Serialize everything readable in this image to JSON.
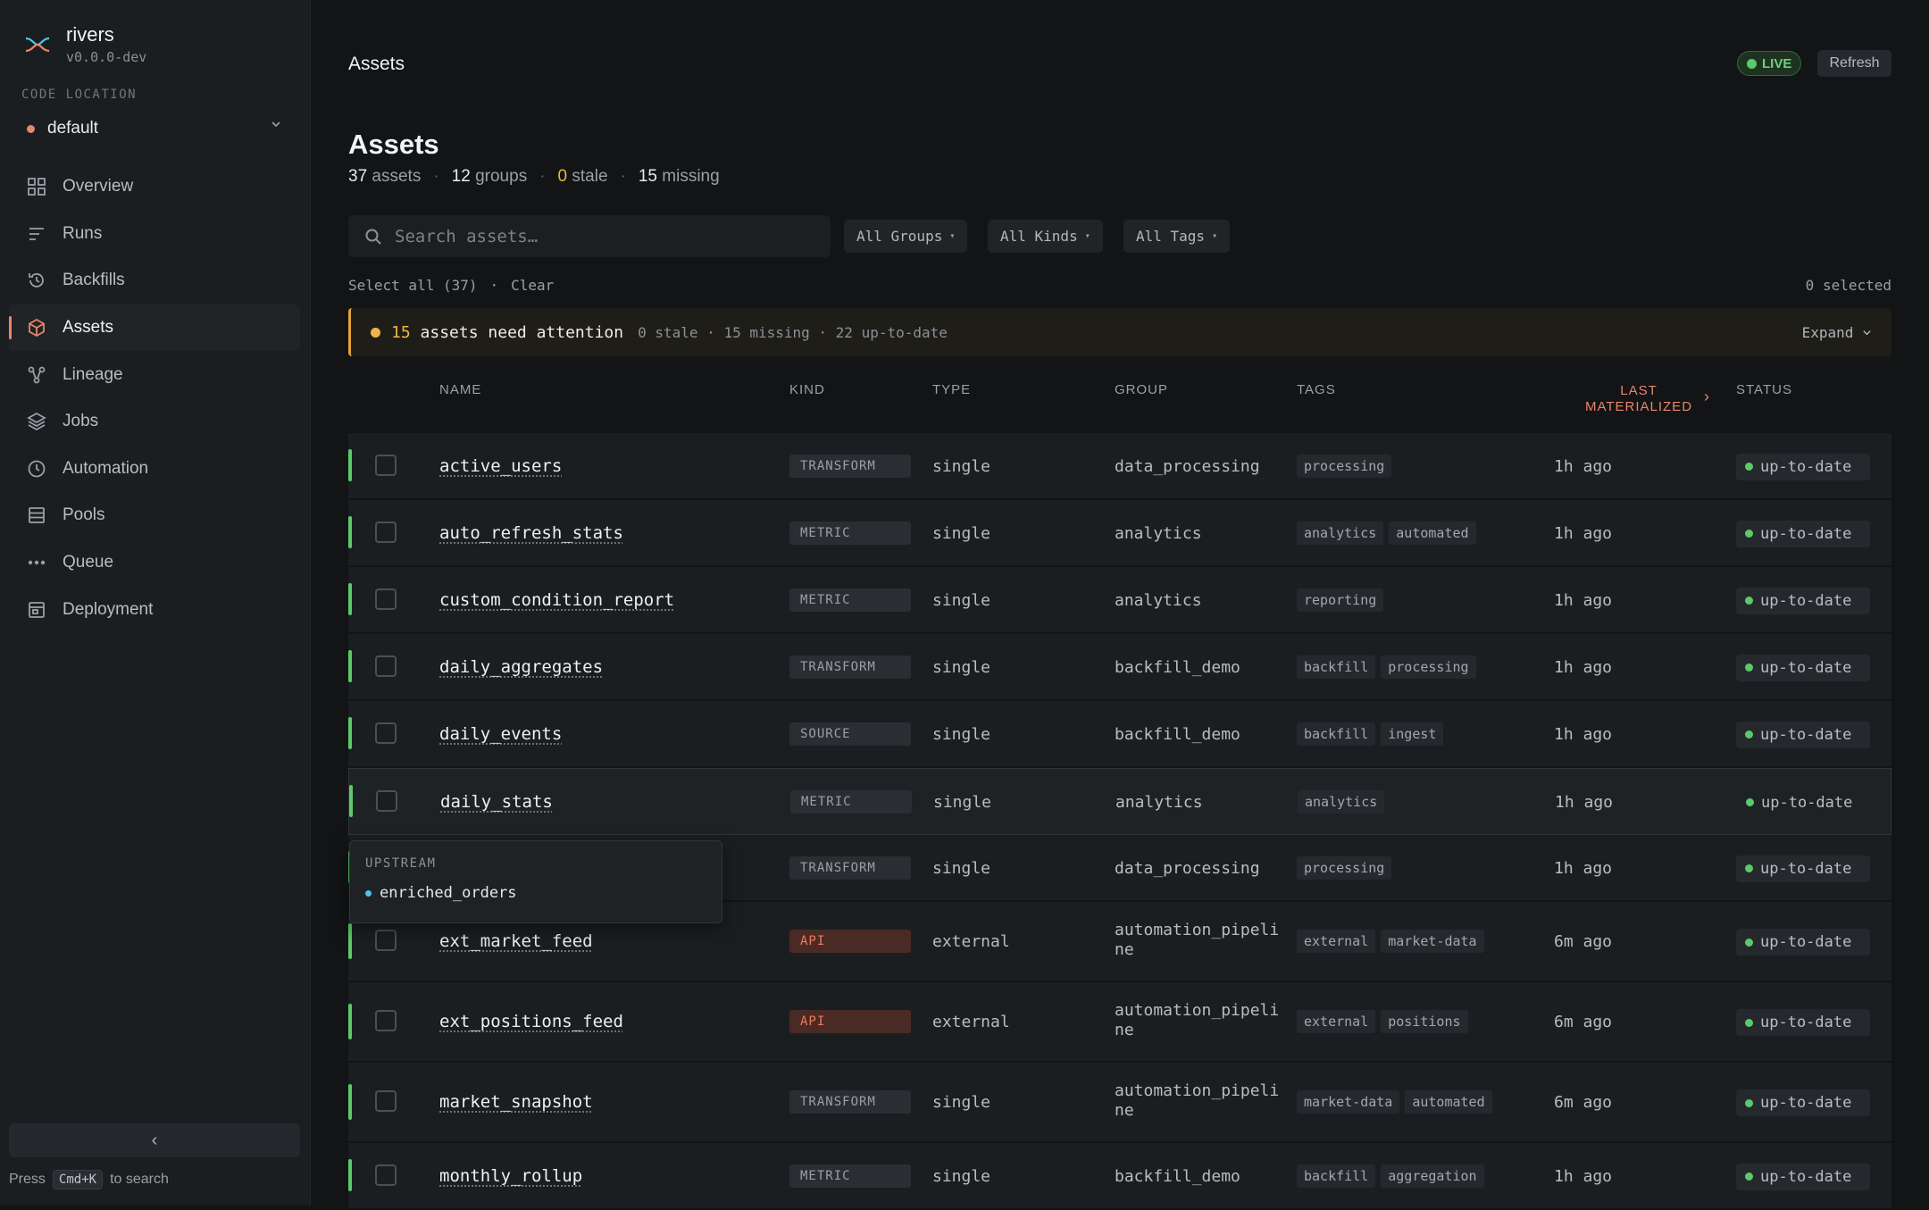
{
  "brand": {
    "name": "rivers",
    "version": "v0.0.0-dev"
  },
  "code_location": {
    "label": "CODE LOCATION",
    "value": "default"
  },
  "nav": [
    {
      "label": "Overview",
      "icon": "grid-icon"
    },
    {
      "label": "Runs",
      "icon": "lines-icon"
    },
    {
      "label": "Backfills",
      "icon": "history-icon"
    },
    {
      "label": "Assets",
      "icon": "cube-icon",
      "active": true
    },
    {
      "label": "Lineage",
      "icon": "lineage-icon"
    },
    {
      "label": "Jobs",
      "icon": "layers-icon"
    },
    {
      "label": "Automation",
      "icon": "clock-icon"
    },
    {
      "label": "Pools",
      "icon": "database-icon"
    },
    {
      "label": "Queue",
      "icon": "dots-icon"
    },
    {
      "label": "Deployment",
      "icon": "deployment-icon"
    }
  ],
  "sidebar_footer": {
    "collapse": "‹",
    "hint_prefix": "Press",
    "hint_key": "Cmd+K",
    "hint_suffix": "to search"
  },
  "header": {
    "breadcrumb": "Assets",
    "live": "LIVE",
    "refresh": "Refresh"
  },
  "page": {
    "title": "Assets",
    "stats": [
      {
        "num": "37",
        "label": "assets"
      },
      {
        "num": "12",
        "label": "groups"
      },
      {
        "num": "0",
        "label": "stale"
      },
      {
        "num": "15",
        "label": "missing"
      }
    ]
  },
  "filters": {
    "search_placeholder": "Search assets…",
    "groups": "All Groups",
    "kinds": "All Kinds",
    "tags": "All Tags"
  },
  "selection": {
    "select_all": "Select all (37)",
    "dot": "·",
    "clear": "Clear",
    "selected": "0 selected"
  },
  "banner": {
    "count": "15",
    "text": "assets need attention",
    "detail": "0 stale · 15 missing · 22 up-to-date",
    "expand": "Expand"
  },
  "columns": {
    "name": "NAME",
    "kind": "KIND",
    "type": "TYPE",
    "group": "GROUP",
    "tags": "TAGS",
    "last_line1": "LAST",
    "last_line2": "MATERIALIZED",
    "status": "STATUS"
  },
  "rows": [
    {
      "name": "active_users",
      "kind": "TRANSFORM",
      "type": "single",
      "group": "data_processing",
      "tags": [
        "processing"
      ],
      "last": "1h ago",
      "status": "up-to-date"
    },
    {
      "name": "auto_refresh_stats",
      "kind": "METRIC",
      "type": "single",
      "group": "analytics",
      "tags": [
        "analytics",
        "automated"
      ],
      "last": "1h ago",
      "status": "up-to-date"
    },
    {
      "name": "custom_condition_report",
      "kind": "METRIC",
      "type": "single",
      "group": "analytics",
      "tags": [
        "reporting"
      ],
      "last": "1h ago",
      "status": "up-to-date"
    },
    {
      "name": "daily_aggregates",
      "kind": "TRANSFORM",
      "type": "single",
      "group": "backfill_demo",
      "tags": [
        "backfill",
        "processing"
      ],
      "last": "1h ago",
      "status": "up-to-date"
    },
    {
      "name": "daily_events",
      "kind": "SOURCE",
      "type": "single",
      "group": "backfill_demo",
      "tags": [
        "backfill",
        "ingest"
      ],
      "last": "1h ago",
      "status": "up-to-date"
    },
    {
      "name": "daily_stats",
      "kind": "METRIC",
      "type": "single",
      "group": "analytics",
      "tags": [
        "analytics"
      ],
      "last": "1h ago",
      "status": "up-to-date"
    },
    {
      "name": "",
      "kind": "TRANSFORM",
      "type": "single",
      "group": "data_processing",
      "tags": [
        "processing"
      ],
      "last": "1h ago",
      "status": "up-to-date"
    },
    {
      "name": "ext_market_feed",
      "kind": "API",
      "type": "external",
      "group": "automation_pipeline",
      "tags": [
        "external",
        "market-data"
      ],
      "last": "6m ago",
      "status": "up-to-date"
    },
    {
      "name": "ext_positions_feed",
      "kind": "API",
      "type": "external",
      "group": "automation_pipeline",
      "tags": [
        "external",
        "positions"
      ],
      "last": "6m ago",
      "status": "up-to-date"
    },
    {
      "name": "market_snapshot",
      "kind": "TRANSFORM",
      "type": "single",
      "group": "automation_pipeline",
      "tags": [
        "market-data",
        "automated"
      ],
      "last": "6m ago",
      "status": "up-to-date"
    },
    {
      "name": "monthly_rollup",
      "kind": "METRIC",
      "type": "single",
      "group": "backfill_demo",
      "tags": [
        "backfill",
        "aggregation"
      ],
      "last": "1h ago",
      "status": "up-to-date"
    }
  ],
  "tooltip": {
    "title": "UPSTREAM",
    "item": "enriched_orders"
  },
  "colors": {
    "accent": "#e8866b",
    "success": "#5cc96a",
    "warning": "#f0b54a",
    "info": "#4fc3e8"
  }
}
